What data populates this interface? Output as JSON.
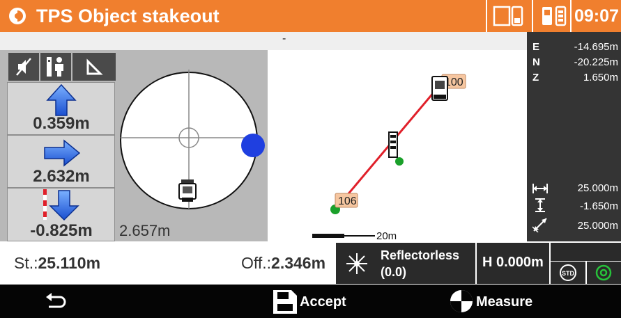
{
  "header": {
    "title": "TPS Object stakeout",
    "time": "09:07",
    "icons": [
      "app-logo-icon",
      "controller-battery-icon",
      "instrument-battery-icon"
    ]
  },
  "status_strip": {
    "text": "-"
  },
  "toolbar": {
    "icons": [
      "sound-mute-icon",
      "surveyor-icon",
      "triangle-icon"
    ]
  },
  "navigation": {
    "forward": {
      "value": "0.359m",
      "direction": "up-arrow-icon"
    },
    "lateral": {
      "value": "2.632m",
      "direction": "right-arrow-icon"
    },
    "height": {
      "value": "-0.825m",
      "direction": "down-arrow-icon"
    },
    "distance": "2.657m"
  },
  "coordinates": [
    {
      "label": "E",
      "value": "-14.695m"
    },
    {
      "label": "N",
      "value": "-20.225m"
    },
    {
      "label": "Z",
      "value": "1.650m"
    }
  ],
  "dimensions": [
    {
      "icon": "horizontal-distance-icon",
      "value": "25.000m"
    },
    {
      "icon": "vertical-distance-icon",
      "value": "-1.650m"
    },
    {
      "icon": "slope-distance-icon",
      "value": "25.000m"
    }
  ],
  "map": {
    "point_labels": [
      "100",
      "106"
    ],
    "scale_label": "20m"
  },
  "info": {
    "station_label": "St.:",
    "station_value": "25.110m",
    "offset_label": "Off.:",
    "offset_value": "2.346m"
  },
  "edm": {
    "mode": "Reflectorless",
    "value": "(0.0)"
  },
  "height": {
    "label": "H 0.000m"
  },
  "options": {
    "std_label": "STD"
  },
  "footer": {
    "accept_label": "Accept",
    "measure_label": "Measure"
  },
  "colors": {
    "header": "#f07f2e",
    "line": "#e0202a",
    "point": "#1aa02a",
    "target": "#1f3fe0"
  }
}
